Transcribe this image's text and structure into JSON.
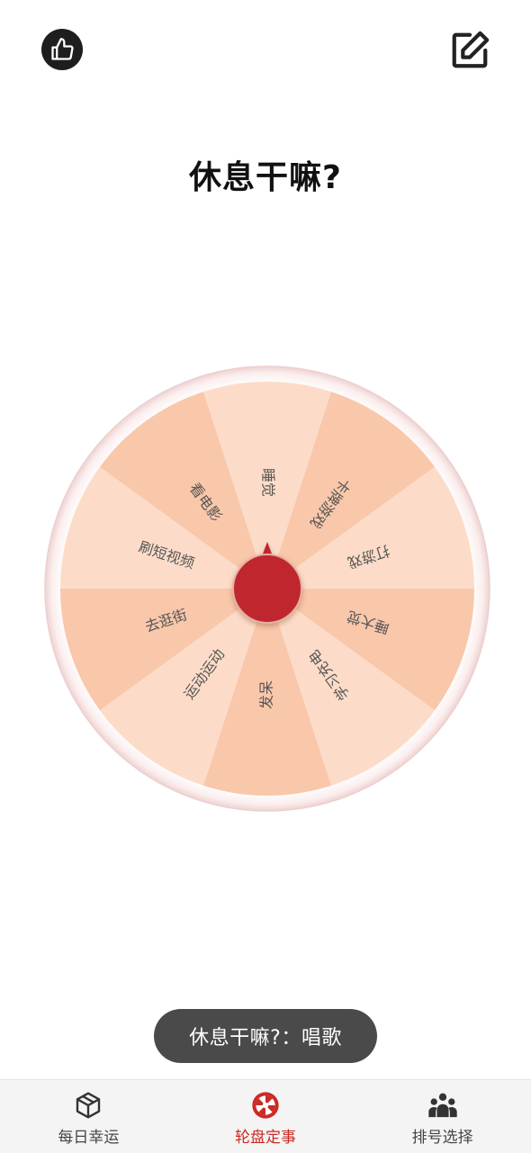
{
  "header": {
    "like_icon": "thumbs-up-icon",
    "edit_icon": "edit-icon"
  },
  "title": "休息干嘛?",
  "wheel": {
    "segments": [
      {
        "label": "睡觉",
        "color": "#fcdcc8"
      },
      {
        "label": "卡牌游戏",
        "color": "#f9c7aa"
      },
      {
        "label": "打游戏",
        "color": "#fcdcc8"
      },
      {
        "label": "睡大觉",
        "color": "#f9c7aa"
      },
      {
        "label": "学习充电",
        "color": "#fcdcc8"
      },
      {
        "label": "发呆",
        "color": "#f9c7aa"
      },
      {
        "label": "运动运动",
        "color": "#fcdcc8"
      },
      {
        "label": "去逛街",
        "color": "#f9c7aa"
      },
      {
        "label": "刷短视频",
        "color": "#fcdcc8"
      },
      {
        "label": "看电影",
        "color": "#f9c7aa"
      }
    ],
    "pointer_color": "#c0262d",
    "rim_color": "#f3d6d6"
  },
  "toast": {
    "text": "休息干嘛?：唱歌"
  },
  "nav": {
    "items": [
      {
        "label": "每日幸运",
        "icon": "box-icon",
        "active": false
      },
      {
        "label": "轮盘定事",
        "icon": "wheel-icon",
        "active": true
      },
      {
        "label": "排号选择",
        "icon": "people-icon",
        "active": false
      }
    ],
    "active_color": "#cc2a24"
  }
}
